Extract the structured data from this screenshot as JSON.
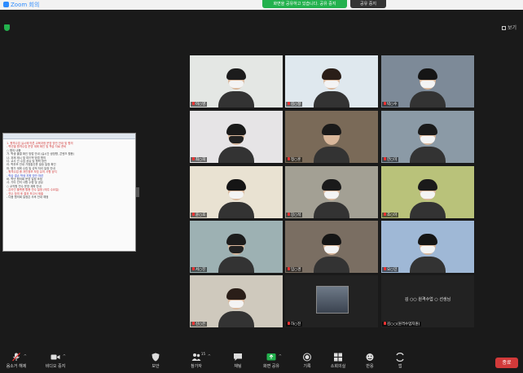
{
  "title_bar": {
    "app_name": "Zoom 회의"
  },
  "share_banner": {
    "status": "화면을 공유하고 있습니다. 공유 중지",
    "stop_label": "공유 중지"
  },
  "view": {
    "label": "보기"
  },
  "document": {
    "lines": [
      {
        "text": "1. 원격수업 실시에 따른 교육과정 운영 방안 안내 및 협의",
        "color": "red"
      },
      {
        "text": "   - 학년별 원격수업 운영 계획 확인 및 학습 자료 준비",
        "color": "red"
      },
      {
        "text": "",
        "color": "plain"
      },
      {
        "text": "○ 협의 내용",
        "color": "plain"
      },
      {
        "text": "  가. 학생 출결 확인 방법 안내 (실시간 쌍방향, 콘텐츠 활용)",
        "color": "plain"
      },
      {
        "text": "  나. 과제 제시 및 피드백 방법 협의",
        "color": "plain"
      },
      {
        "text": "  다. 교사 간 수업 공유 및 협력 방안",
        "color": "plain"
      },
      {
        "text": "  라. 학부모 안내 가정통신문 발송 일정 확인",
        "color": "plain"
      },
      {
        "text": "  마. 평가 계획 수립 및 성적 처리 일정 안내",
        "color": "plain"
      },
      {
        "text": "  - 원격수업 중 개인정보 보호 유의 사항 공지",
        "color": "red"
      },
      {
        "text": "  - 학습 결손 학생 지원 방안 마련",
        "color": "blue"
      },
      {
        "text": "  바. 학년 협의회 운영 일정 조정",
        "color": "plain"
      },
      {
        "text": "  사. 기타 건의 사항 수렴 및 공유",
        "color": "plain"
      },
      {
        "text": "",
        "color": "plain"
      },
      {
        "text": "○ 교직원 연수 운영 계획 안내",
        "color": "plain"
      },
      {
        "text": "  - 온라인 플랫폼 활용 연수 일정 (매주 수요일)",
        "color": "red"
      },
      {
        "text": "  - 연수 참여 후 결과 보고서 제출",
        "color": "red"
      },
      {
        "text": "  - 다음 협의회 일정은 추후 안내 예정",
        "color": "plain"
      }
    ]
  },
  "participants": [
    {
      "name": "이○영",
      "bg": "#e4e7e4",
      "hair": "#1c1c1c",
      "mask": "white",
      "active": false
    },
    {
      "name": "김○정",
      "bg": "#dfe8ee",
      "hair": "#2a1e18",
      "mask": "white",
      "active": false
    },
    {
      "name": "박○수",
      "bg": "#7d8a98",
      "hair": "#151515",
      "mask": "white",
      "active": false
    },
    {
      "name": "최○희",
      "bg": "#e6e4e6",
      "hair": "#1a1a1a",
      "mask": "dark",
      "active": false
    },
    {
      "name": "정○훈",
      "bg": "#7a6a58",
      "hair": "#1a1a1a",
      "mask": "none",
      "active": true
    },
    {
      "name": "한○미",
      "bg": "#8b9aa6",
      "hair": "#1a1a1a",
      "mask": "white",
      "active": false
    },
    {
      "name": "윤○호",
      "bg": "#e9e2d2",
      "hair": "#151515",
      "mask": "white",
      "active": false
    },
    {
      "name": "강○석",
      "bg": "#a3a094",
      "hair": "#1a1a1a",
      "mask": "white",
      "active": false
    },
    {
      "name": "조○아",
      "bg": "#b9c27a",
      "hair": "#1a1a1a",
      "mask": "white",
      "active": false
    },
    {
      "name": "서○진",
      "bg": "#9db1b3",
      "hair": "#1c1c1c",
      "mask": "dark",
      "active": false
    },
    {
      "name": "임○경",
      "bg": "#7a6e62",
      "hair": "#151515",
      "mask": "white",
      "active": false
    },
    {
      "name": "오○민",
      "bg": "#9fb8d6",
      "hair": "#151515",
      "mask": "white",
      "active": false
    },
    {
      "name": "신○은",
      "bg": "#cfc9bd",
      "hair": "#2a1e18",
      "mask": "white",
      "active": false
    }
  ],
  "photo_tile": {
    "name": "하○진"
  },
  "text_tile": {
    "center_label": "김 ○○ 원격수업 ○ 선생님",
    "name": "김○○(원격수업지원)"
  },
  "toolbar": {
    "mute": "음소거 해제",
    "video": "비디오 중지",
    "security": "보안",
    "participants": "참가자",
    "participants_count": "15",
    "chat": "채팅",
    "share": "화면 공유",
    "record": "기록",
    "breakout": "소회의실",
    "reactions": "반응",
    "apps": "앱",
    "end": "종료"
  },
  "colors": {
    "active_speaker": "#c9d52b",
    "share_green": "#23b14d",
    "end_red": "#d23a3a",
    "muted_red": "#e33333"
  }
}
